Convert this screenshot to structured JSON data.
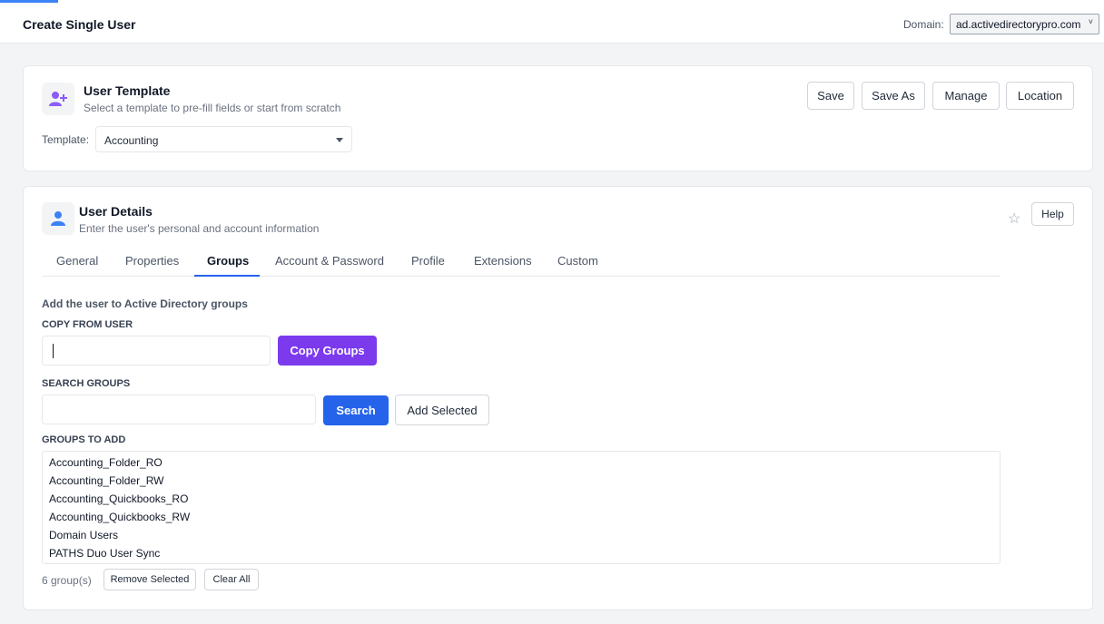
{
  "header": {
    "title": "Create Single User",
    "domain_label": "Domain:",
    "domain_value": "ad.activedirectorypro.com"
  },
  "template_card": {
    "title": "User Template",
    "subtitle": "Select a template to pre-fill fields or start from scratch",
    "buttons": {
      "save": "Save",
      "save_as": "Save As",
      "manage": "Manage",
      "location": "Location"
    },
    "template_label": "Template:",
    "template_value": "Accounting"
  },
  "details_card": {
    "title": "User Details",
    "subtitle": "Enter the user's personal and account information",
    "help": "Help",
    "star": "☆",
    "tabs": [
      "General",
      "Properties",
      "Groups",
      "Account & Password",
      "Profile",
      "Extensions",
      "Custom"
    ],
    "active_tab": "Groups"
  },
  "groups": {
    "heading": "Add the user to Active Directory groups",
    "copy_label": "COPY FROM USER",
    "copy_value": "",
    "copy_button": "Copy Groups",
    "search_label": "SEARCH GROUPS",
    "search_value": "",
    "search_button": "Search",
    "add_selected": "Add Selected",
    "to_add_label": "GROUPS TO ADD",
    "items": [
      "Accounting_Folder_RO",
      "Accounting_Folder_RW",
      "Accounting_Quickbooks_RO",
      "Accounting_Quickbooks_RW",
      "Domain Users",
      "PATHS Duo User Sync"
    ],
    "count": "6 group(s)",
    "remove_selected": "Remove Selected",
    "clear_all": "Clear All"
  },
  "colors": {
    "accent_blue": "#2563eb",
    "accent_purple": "#7c3aed"
  }
}
